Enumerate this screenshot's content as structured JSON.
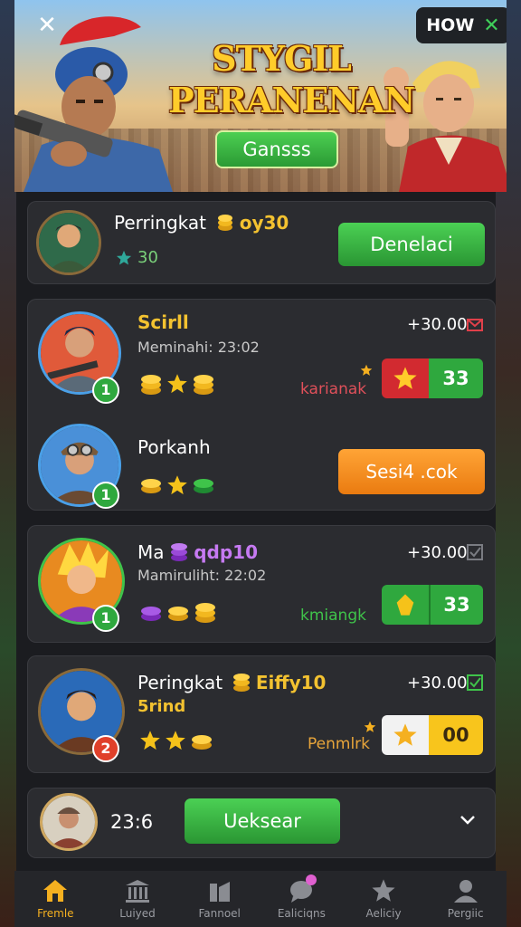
{
  "header": {
    "close_glyph": "✕",
    "how_label": "HOW",
    "how_close_glyph": "✕",
    "title_line1": "STYGIL",
    "title_line2": "PERANENAN",
    "primary_button": "Gansss"
  },
  "rank_card": {
    "label": "Perringkat",
    "coin_text": "oy30",
    "star_value": "30",
    "action_button": "Denelaci"
  },
  "matches": [
    {
      "name": "Scirll",
      "subtitle": "Meminahi: 23:02",
      "level": "1",
      "amount": "+30.00",
      "status_label": "karianak",
      "status_color": "#e0505a",
      "score": "33"
    },
    {
      "name": "Porkanh",
      "level": "1",
      "action_button": "Sesi4 .cok"
    },
    {
      "name_prefix": "Ma",
      "name_suffix": "qdp10",
      "subtitle": "Mamiruliht: 22:02",
      "level": "1",
      "amount": "+30.00",
      "status_label": "kmiangk",
      "status_color": "#3fc34a",
      "score": "33"
    },
    {
      "name_prefix": "Peringkat",
      "name_suffix": "Eiffy10",
      "subtitle": "5rind",
      "level": "2",
      "amount": "+30.00",
      "status_label": "Penmlrk",
      "status_color": "#e8a53a",
      "score": "00"
    }
  ],
  "bottom_bar": {
    "time": "23:6",
    "action_button": "Ueksear"
  },
  "nav": [
    {
      "label": "Fremle",
      "icon": "home-icon",
      "active": true
    },
    {
      "label": "Luiyed",
      "icon": "columns-icon",
      "active": false
    },
    {
      "label": "Fannoel",
      "icon": "building-icon",
      "active": false
    },
    {
      "label": "Ealiciqns",
      "icon": "chat-icon",
      "active": false
    },
    {
      "label": "Aeliciy",
      "icon": "star-icon",
      "active": false
    },
    {
      "label": "Pergiic",
      "icon": "profile-icon",
      "active": false
    }
  ],
  "colors": {
    "accent_green": "#3fbf48",
    "accent_orange": "#f48d1e",
    "gold": "#f3c230",
    "card_bg": "#2b2c30"
  }
}
